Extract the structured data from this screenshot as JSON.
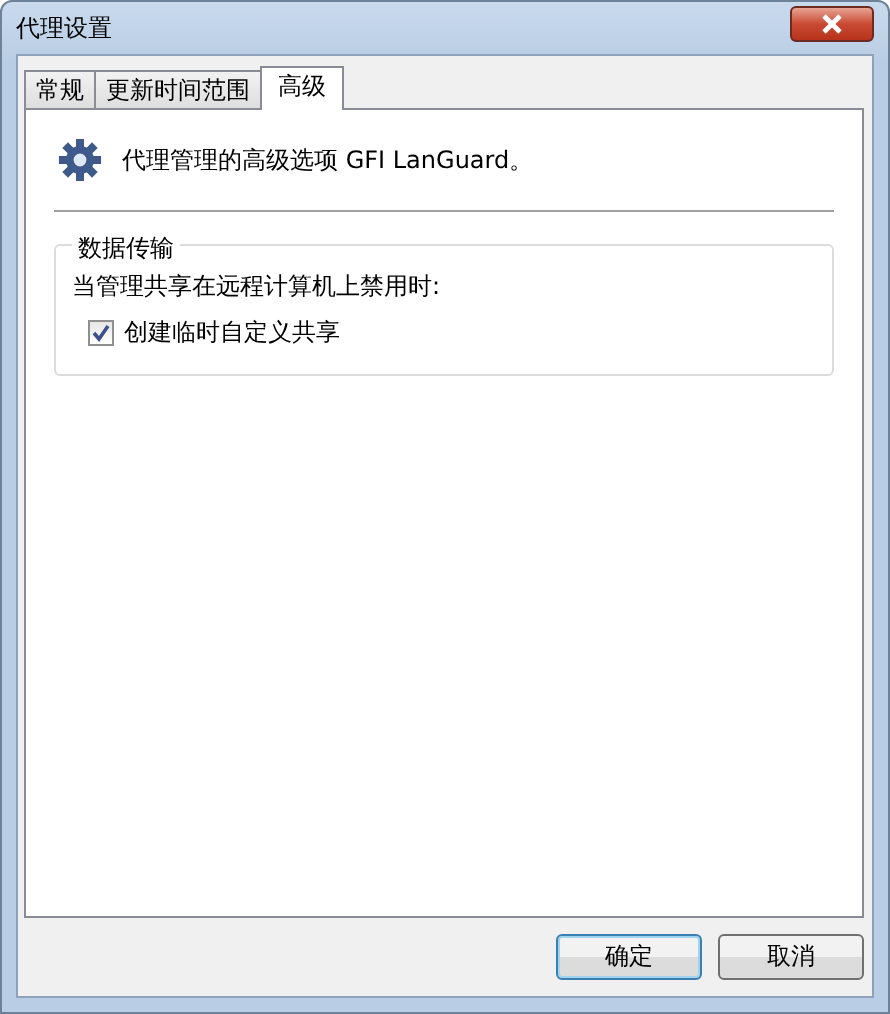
{
  "window": {
    "title": "代理设置"
  },
  "tabs": [
    {
      "label": "常规",
      "selected": false
    },
    {
      "label": "更新时间范围",
      "selected": false
    },
    {
      "label": "高级",
      "selected": true
    }
  ],
  "header": {
    "text": "代理管理的高级选项 GFI LanGuard。"
  },
  "group": {
    "title": "数据传输",
    "label": "当管理共享在远程计算机上禁用时:",
    "checkbox": {
      "label": "创建临时自定义共享",
      "checked": true
    }
  },
  "buttons": [
    {
      "label": "确定",
      "default": true
    },
    {
      "label": "取消",
      "default": false
    }
  ]
}
